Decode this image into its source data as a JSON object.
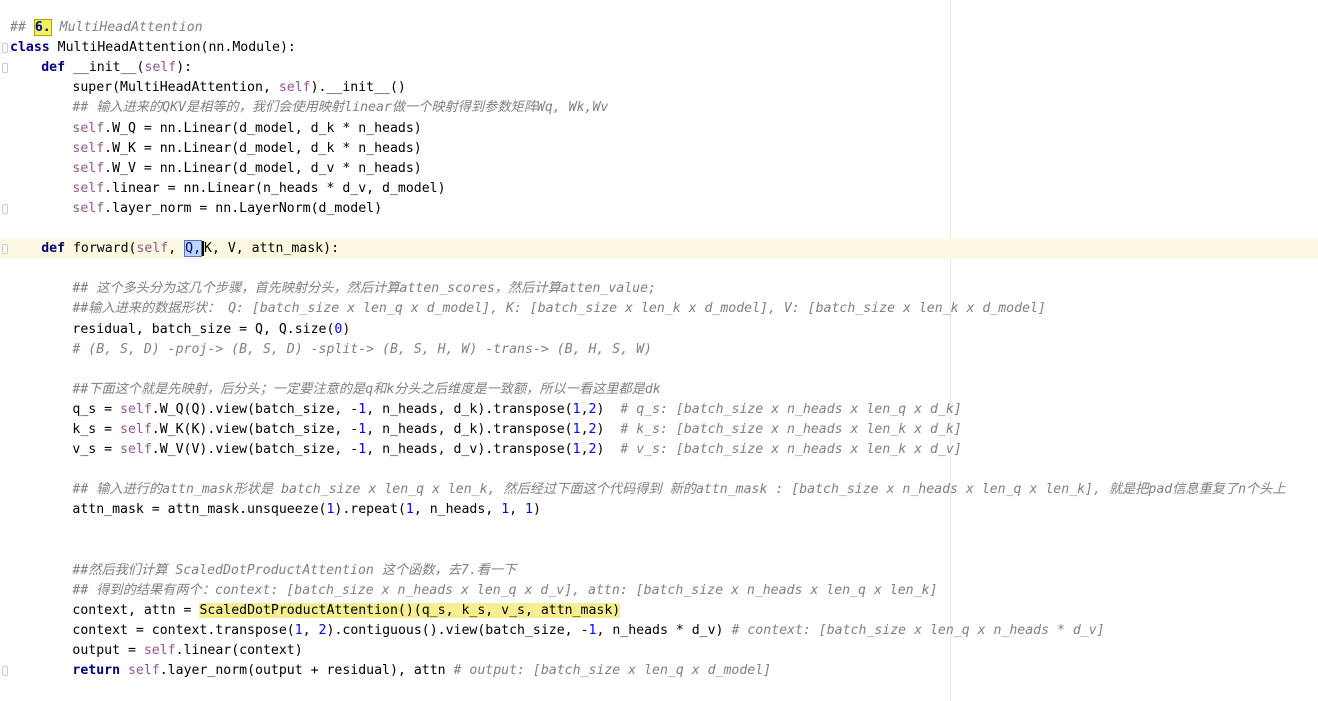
{
  "editor": {
    "lines": [
      {
        "id": "l1",
        "indent": 0,
        "segs": [
          [
            "cm",
            "## "
          ],
          [
            "badge",
            "6."
          ],
          [
            "cm",
            " MultiHeadAttention"
          ]
        ]
      },
      {
        "id": "l2",
        "indent": 0,
        "segs": [
          [
            "kw",
            "class"
          ],
          [
            "p",
            " MultiHeadAttention(nn.Module):"
          ]
        ]
      },
      {
        "id": "l3",
        "indent": 1,
        "segs": [
          [
            "kw",
            "def"
          ],
          [
            "p",
            " "
          ],
          [
            "fn",
            "__init__"
          ],
          [
            "p",
            "("
          ],
          [
            "sf",
            "self"
          ],
          [
            "p",
            "):"
          ]
        ]
      },
      {
        "id": "l4",
        "indent": 2,
        "segs": [
          [
            "p",
            "super(MultiHeadAttention, "
          ],
          [
            "sf",
            "self"
          ],
          [
            "p",
            ").__init__()"
          ]
        ]
      },
      {
        "id": "l5",
        "indent": 2,
        "segs": [
          [
            "cm",
            "## 输入进来的QKV是相等的，我们会使用映射linear做一个映射得到参数矩阵Wq, Wk,Wv"
          ]
        ]
      },
      {
        "id": "l6",
        "indent": 2,
        "segs": [
          [
            "sf",
            "self"
          ],
          [
            "p",
            ".W_Q = nn.Linear(d_model, d_k * n_heads)"
          ]
        ]
      },
      {
        "id": "l7",
        "indent": 2,
        "segs": [
          [
            "sf",
            "self"
          ],
          [
            "p",
            ".W_K = nn.Linear(d_model, d_k * n_heads)"
          ]
        ]
      },
      {
        "id": "l8",
        "indent": 2,
        "segs": [
          [
            "sf",
            "self"
          ],
          [
            "p",
            ".W_V = nn.Linear(d_model, d_v * n_heads)"
          ]
        ]
      },
      {
        "id": "l9",
        "indent": 2,
        "segs": [
          [
            "sf",
            "self"
          ],
          [
            "p",
            ".linear = nn.Linear(n_heads * d_v, d_model)"
          ]
        ]
      },
      {
        "id": "l10",
        "indent": 2,
        "segs": [
          [
            "sf",
            "self"
          ],
          [
            "p",
            ".layer_norm = nn.LayerNorm(d_model)"
          ]
        ]
      },
      {
        "id": "l11",
        "indent": 0,
        "segs": []
      },
      {
        "id": "l12",
        "indent": 1,
        "hl": true,
        "segs": [
          [
            "kw",
            "def"
          ],
          [
            "p",
            " forward("
          ],
          [
            "sf",
            "self"
          ],
          [
            "p",
            ", "
          ],
          [
            "sel",
            "Q,"
          ],
          [
            "cur",
            ""
          ],
          [
            "p",
            "K, V, attn_mask):"
          ]
        ]
      },
      {
        "id": "l13",
        "indent": 0,
        "segs": []
      },
      {
        "id": "l14",
        "indent": 2,
        "segs": [
          [
            "cm",
            "## 这个多头分为这几个步骤，首先映射分头，然后计算atten_scores，然后计算atten_value;"
          ]
        ]
      },
      {
        "id": "l15",
        "indent": 2,
        "segs": [
          [
            "cm",
            "##输入进来的数据形状： Q: [batch_size x len_q x d_model], K: [batch_size x len_k x d_model], V: [batch_size x len_k x d_model]"
          ]
        ]
      },
      {
        "id": "l16",
        "indent": 2,
        "segs": [
          [
            "p",
            "residual, batch_size = Q, Q.size("
          ],
          [
            "nm",
            "0"
          ],
          [
            "p",
            ")"
          ]
        ]
      },
      {
        "id": "l17",
        "indent": 2,
        "segs": [
          [
            "cm",
            "# (B, S, D) -proj-> (B, S, D) -split-> (B, S, H, W) -trans-> (B, H, S, W)"
          ]
        ]
      },
      {
        "id": "l18",
        "indent": 0,
        "segs": []
      },
      {
        "id": "l19",
        "indent": 2,
        "segs": [
          [
            "cm",
            "##下面这个就是先映射，后分头；一定要注意的是q和k分头之后维度是一致额，所以一看这里都是dk"
          ]
        ]
      },
      {
        "id": "l20",
        "indent": 2,
        "segs": [
          [
            "p",
            "q_s = "
          ],
          [
            "sf",
            "self"
          ],
          [
            "p",
            ".W_Q(Q).view(batch_size, -"
          ],
          [
            "nm",
            "1"
          ],
          [
            "p",
            ", n_heads, d_k).transpose("
          ],
          [
            "nm",
            "1"
          ],
          [
            "p",
            ","
          ],
          [
            "nm",
            "2"
          ],
          [
            "p",
            ")  "
          ],
          [
            "cm",
            "# q_s: [batch_size x n_heads x len_q x d_k]"
          ]
        ]
      },
      {
        "id": "l21",
        "indent": 2,
        "segs": [
          [
            "p",
            "k_s = "
          ],
          [
            "sf",
            "self"
          ],
          [
            "p",
            ".W_K(K).view(batch_size, -"
          ],
          [
            "nm",
            "1"
          ],
          [
            "p",
            ", n_heads, d_k).transpose("
          ],
          [
            "nm",
            "1"
          ],
          [
            "p",
            ","
          ],
          [
            "nm",
            "2"
          ],
          [
            "p",
            ")  "
          ],
          [
            "cm",
            "# k_s: [batch_size x n_heads x len_k x d_k]"
          ]
        ]
      },
      {
        "id": "l22",
        "indent": 2,
        "segs": [
          [
            "p",
            "v_s = "
          ],
          [
            "sf",
            "self"
          ],
          [
            "p",
            ".W_V(V).view(batch_size, -"
          ],
          [
            "nm",
            "1"
          ],
          [
            "p",
            ", n_heads, d_v).transpose("
          ],
          [
            "nm",
            "1"
          ],
          [
            "p",
            ","
          ],
          [
            "nm",
            "2"
          ],
          [
            "p",
            ")  "
          ],
          [
            "cm",
            "# v_s: [batch_size x n_heads x len_k x d_v]"
          ]
        ]
      },
      {
        "id": "l23",
        "indent": 0,
        "segs": []
      },
      {
        "id": "l24",
        "indent": 2,
        "segs": [
          [
            "cm",
            "## 输入进行的attn_mask形状是 batch_size x len_q x len_k, 然后经过下面这个代码得到 新的attn_mask : [batch_size x n_heads x len_q x len_k], 就是把pad信息重复了n个头上"
          ]
        ]
      },
      {
        "id": "l25",
        "indent": 2,
        "segs": [
          [
            "p",
            "attn_mask = attn_mask.unsqueeze("
          ],
          [
            "nm",
            "1"
          ],
          [
            "p",
            ").repeat("
          ],
          [
            "nm",
            "1"
          ],
          [
            "p",
            ", n_heads, "
          ],
          [
            "nm",
            "1"
          ],
          [
            "p",
            ", "
          ],
          [
            "nm",
            "1"
          ],
          [
            "p",
            ")"
          ]
        ]
      },
      {
        "id": "l26",
        "indent": 0,
        "segs": []
      },
      {
        "id": "l27",
        "indent": 0,
        "segs": []
      },
      {
        "id": "l28",
        "indent": 2,
        "segs": [
          [
            "cm",
            "##然后我们计算 ScaledDotProductAttention 这个函数，去7.看一下"
          ]
        ]
      },
      {
        "id": "l29",
        "indent": 2,
        "segs": [
          [
            "cm",
            "## 得到的结果有两个：context: [batch_size x n_heads x len_q x d_v], attn: [batch_size x n_heads x len_q x len_k]"
          ]
        ]
      },
      {
        "id": "l30",
        "indent": 2,
        "segs": [
          [
            "p",
            "context, attn = "
          ],
          [
            "call",
            "ScaledDotProductAttention()(q_s, k_s, v_s, attn_mask)"
          ]
        ]
      },
      {
        "id": "l31",
        "indent": 2,
        "segs": [
          [
            "p",
            "context = context.transpose("
          ],
          [
            "nm",
            "1"
          ],
          [
            "p",
            ", "
          ],
          [
            "nm",
            "2"
          ],
          [
            "p",
            ").contiguous().view(batch_size, -"
          ],
          [
            "nm",
            "1"
          ],
          [
            "p",
            ", n_heads * d_v) "
          ],
          [
            "cm",
            "# context: [batch_size x len_q x n_heads * d_v]"
          ]
        ]
      },
      {
        "id": "l32",
        "indent": 2,
        "segs": [
          [
            "p",
            "output = "
          ],
          [
            "sf",
            "self"
          ],
          [
            "p",
            ".linear(context)"
          ]
        ]
      },
      {
        "id": "l33",
        "indent": 2,
        "segs": [
          [
            "kw",
            "return"
          ],
          [
            "p",
            " "
          ],
          [
            "sf",
            "self"
          ],
          [
            "p",
            ".layer_norm(output + residual), attn "
          ],
          [
            "cm",
            "# output: [batch_size x len_q x d_model]"
          ]
        ]
      }
    ]
  }
}
